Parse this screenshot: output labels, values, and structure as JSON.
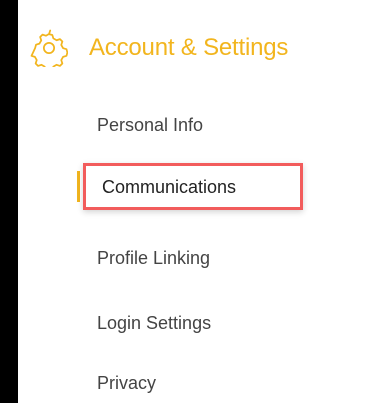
{
  "header": {
    "title": "Account & Settings",
    "icon": "gear-icon",
    "accent_color": "#F2B51E"
  },
  "menu": {
    "items": [
      {
        "label": "Personal Info",
        "active": false
      },
      {
        "label": "Communications",
        "active": true
      },
      {
        "label": "Profile Linking",
        "active": false
      },
      {
        "label": "Login Settings",
        "active": false
      },
      {
        "label": "Privacy",
        "active": false
      }
    ],
    "highlight_color": "#F25C5C",
    "indicator_color": "#F2B51E"
  }
}
